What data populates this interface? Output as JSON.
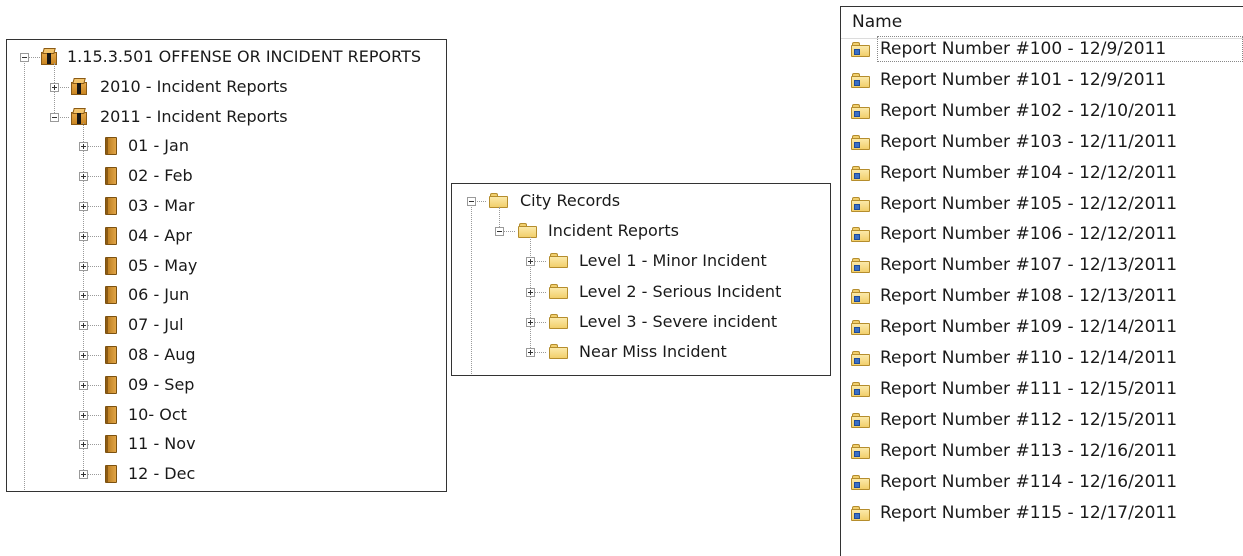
{
  "tree1": {
    "root": {
      "label": "1.15.3.501 OFFENSE OR INCIDENT REPORTS",
      "icon": "archive-box-icon"
    },
    "years": [
      {
        "label": "2010 - Incident Reports",
        "expanded": false
      },
      {
        "label": "2011 - Incident Reports",
        "expanded": true
      }
    ],
    "months": [
      "01 - Jan",
      "02 - Feb",
      "03 - Mar",
      "04 - Apr",
      "05 - May",
      "06 - Jun",
      "07 - Jul",
      "08 - Aug",
      "09 - Sep",
      "10- Oct",
      "11 - Nov",
      "12 - Dec"
    ],
    "month_icon": "binder-icon"
  },
  "tree2": {
    "root": "City Records",
    "child": "Incident Reports",
    "leaves": [
      "Level 1 - Minor Incident",
      "Level 2 - Serious Incident",
      "Level 3 - Severe incident",
      "Near Miss Incident"
    ],
    "icon": "folder-icon"
  },
  "list": {
    "header": "Name",
    "items": [
      "Report Number #100 - 12/9/2011",
      "Report Number #101 - 12/9/2011",
      "Report Number #102 - 12/10/2011",
      "Report Number #103 - 12/11/2011",
      "Report Number #104 - 12/12/2011",
      "Report Number #105 - 12/12/2011",
      "Report Number #106 - 12/12/2011",
      "Report Number #107 - 12/13/2011",
      "Report Number #108 - 12/13/2011",
      "Report Number #109 - 12/14/2011",
      "Report Number #110 - 12/14/2011",
      "Report Number #111 - 12/15/2011",
      "Report Number #112 - 12/15/2011",
      "Report Number #113 - 12/16/2011",
      "Report Number #114 - 12/16/2011",
      "Report Number #115 - 12/17/2011"
    ],
    "focused_index": 0,
    "icon": "folder-shortcut-icon"
  },
  "colors": {
    "border": "#333333",
    "tree_lines": "#9a9a9a",
    "folder": "#f2cf6c",
    "box": "#e7a94a"
  }
}
